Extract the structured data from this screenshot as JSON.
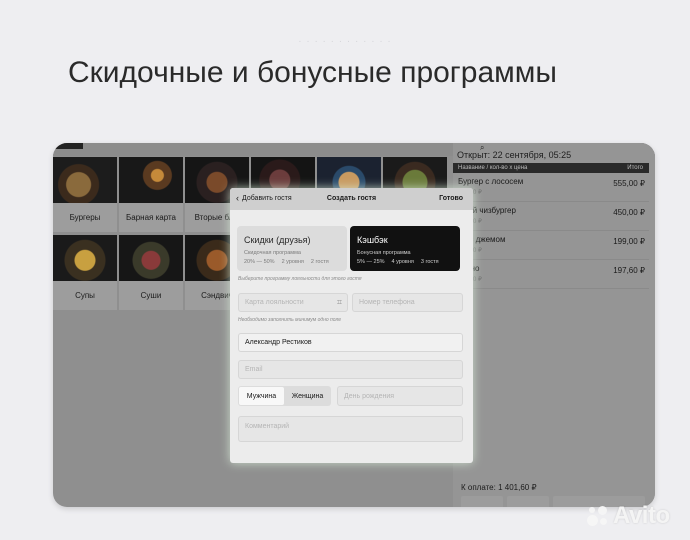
{
  "headline": "Скидочные и бонусные программы",
  "menu": {
    "tiles": [
      {
        "label": "Бургеры",
        "photo": "burger-photo"
      },
      {
        "label": "Барная карта",
        "photo": "cocktail-photo"
      },
      {
        "label": "Вторые блю",
        "photo": "main-course-photo"
      },
      {
        "label": "",
        "photo": "dish-photo"
      },
      {
        "label": "",
        "photo": "pancakes-photo"
      },
      {
        "label": "",
        "photo": "salad-photo"
      },
      {
        "label": "Супы",
        "photo": "soup-photo"
      },
      {
        "label": "Суши",
        "photo": "sushi-photo"
      },
      {
        "label": "Сэндвич",
        "photo": "sandwich-photo"
      }
    ]
  },
  "order": {
    "opened": "Открыт: 22 сентября, 05:25",
    "col_name": "Название / кол-во х цена",
    "col_total": "Итого",
    "items": [
      {
        "name": "Бургер с лососем",
        "sub": "555,00 ₽",
        "price": "555,00 ₽"
      },
      {
        "name": "йный чизбургер",
        "sub": "450,00 ₽",
        "price": "450,00 ₽"
      },
      {
        "name": "ли с джемом",
        "sub": "199,00 ₽",
        "price": "199,00 ₽"
      },
      {
        "name": "учино",
        "sub": "197,60 ₽",
        "price": "197,60 ₽"
      }
    ],
    "total": "К оплате: 1 401,60 ₽"
  },
  "modal": {
    "back": "Добавить гостя",
    "title": "Создать гостя",
    "done": "Готово",
    "programs": [
      {
        "name": "Скидки (друзья)",
        "kind": "Скидочная программа",
        "range": "20% — 50%",
        "levels": "2 уровня",
        "guests": "2 гостя"
      },
      {
        "name": "Кэшбэк",
        "kind": "Бонусная программа",
        "range": "5% — 25%",
        "levels": "4 уровня",
        "guests": "3 гостя"
      }
    ],
    "program_hint": "Выберите программу лояльности для этого гостя",
    "card_placeholder": "Карта лояльности",
    "phone_placeholder": "Номер телефона",
    "field_hint": "Необходимо заполнить минимум одно поле",
    "name_value": "Александр Рестиков",
    "email_placeholder": "Email",
    "gender_male": "Мужчина",
    "gender_female": "Женщина",
    "birthday_placeholder": "День рождения",
    "comment_placeholder": "Комментарий"
  },
  "watermark": "Avito"
}
